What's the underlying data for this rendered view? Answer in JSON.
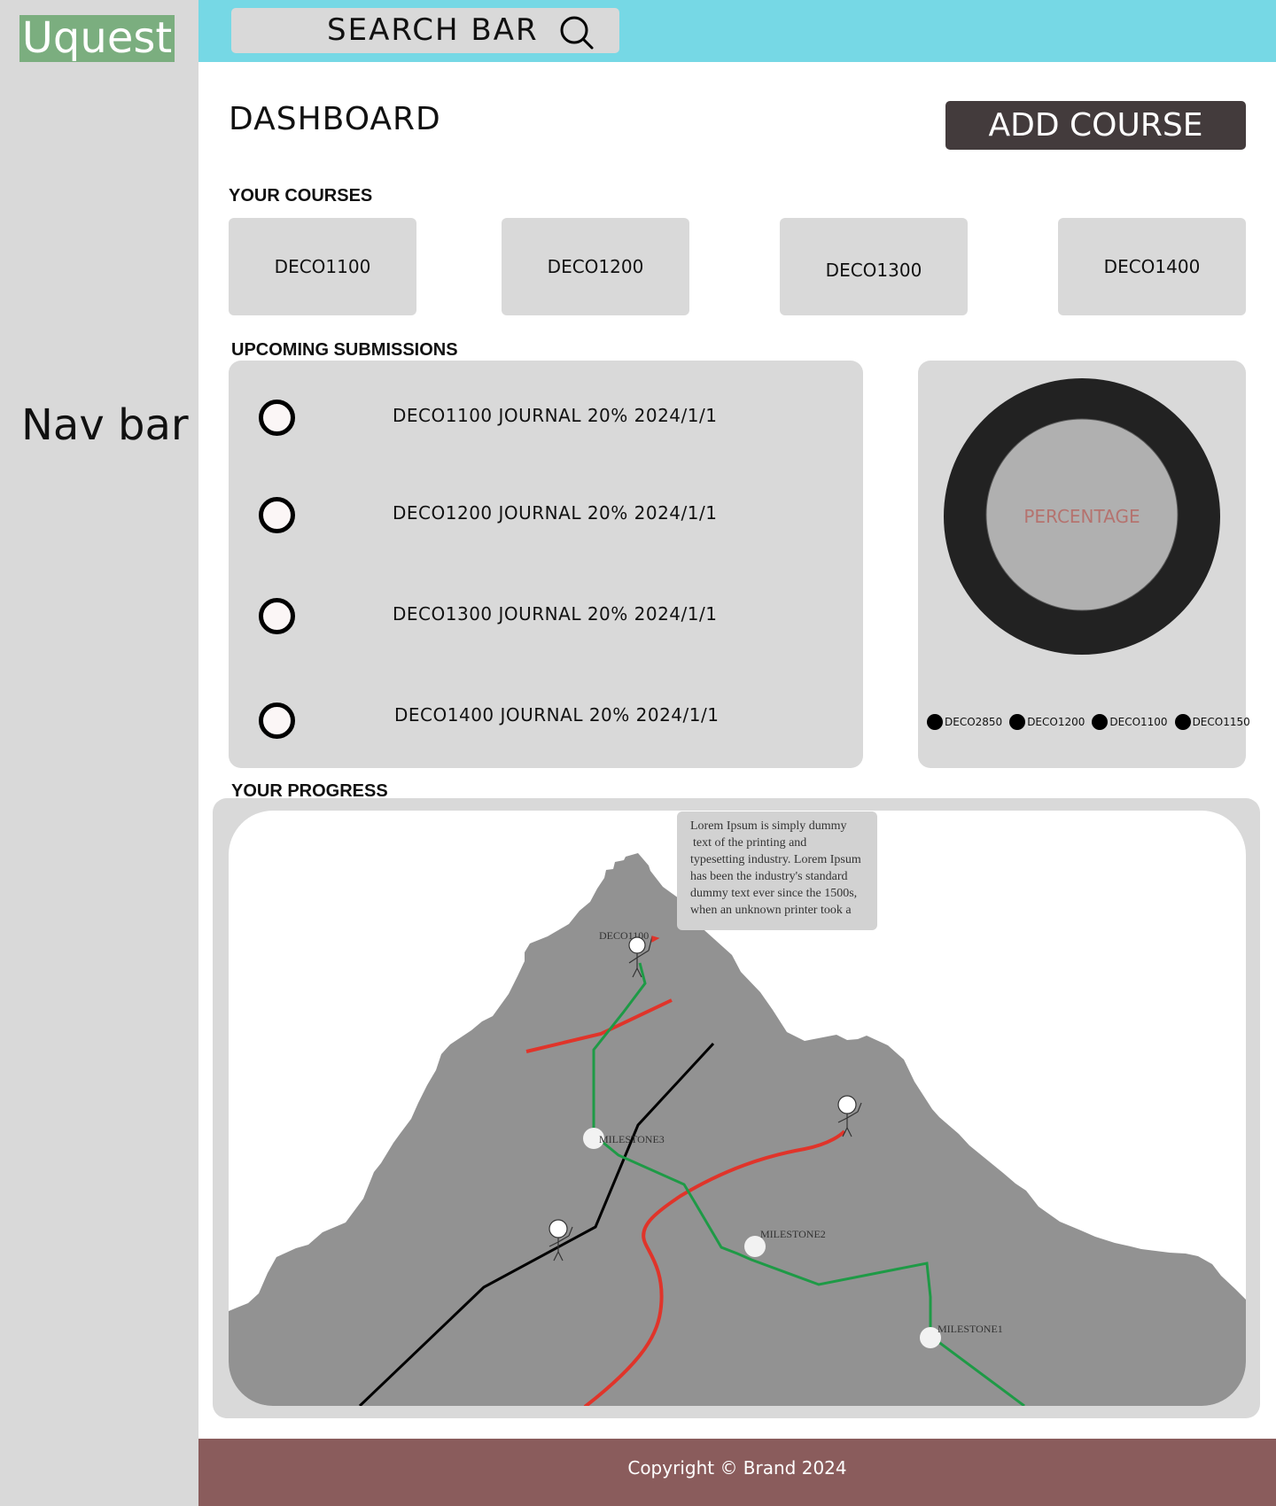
{
  "app": {
    "logo": "Uquest"
  },
  "sidebar": {
    "label": "Nav bar"
  },
  "search": {
    "label": "SEARCH  BAR"
  },
  "header": {
    "title": "DASHBOARD",
    "add_course_label": "ADD COURSE"
  },
  "courses": {
    "section_label": "YOUR COURSES",
    "items": [
      "DECO1100",
      "DECO1200",
      "DECO1300",
      "DECO1400"
    ]
  },
  "submissions": {
    "section_label": "UPCOMING SUBMISSIONS",
    "items": [
      "DECO1100 JOURNAL 20% 2024/1/1",
      "DECO1200 JOURNAL 20% 2024/1/1",
      "DECO1300 JOURNAL 20% 2024/1/1",
      "DECO1400 JOURNAL 20% 2024/1/1"
    ]
  },
  "percentage_widget": {
    "center_label": "PERCENTAGE",
    "legend": [
      "DECO2850",
      "DECO1200",
      "DECO1100",
      "DECO1150"
    ]
  },
  "progress": {
    "section_label": "YOUR PROGRESS",
    "summit_label": "DECO1100",
    "info_text": [
      "Lorem Ipsum is simply dummy",
      "text of the printing and",
      "typesetting industry. Lorem Ipsum",
      "has been the industry's standard",
      "dummy text ever since the 1500s,",
      "when an unknown printer took a"
    ],
    "milestones": [
      "MILESTONE3",
      "MILESTONE2",
      "MILESTONE1"
    ]
  },
  "footer": {
    "copyright": "Copyright © Brand 2024"
  },
  "colors": {
    "sidebar": "#d9d9d9",
    "topbar": "#76d8e5",
    "logo_bg": "#7bae7f",
    "add_button": "#433b3c",
    "footer": "#8a5c5c",
    "ring": "#222222",
    "mountain": "#929292",
    "path_green": "#1e9a46",
    "path_red": "#e0342a",
    "percentage_text": "#b5736f"
  }
}
